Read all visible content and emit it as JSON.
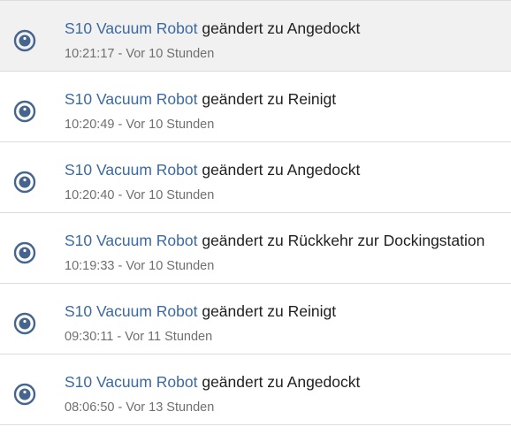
{
  "logbook": {
    "entries": [
      {
        "entity": "S10 Vacuum Robot",
        "message": "geändert zu Angedockt",
        "time": "10:21:17",
        "relative": "Vor 10 Stunden"
      },
      {
        "entity": "S10 Vacuum Robot",
        "message": "geändert zu Reinigt",
        "time": "10:20:49",
        "relative": "Vor 10 Stunden"
      },
      {
        "entity": "S10 Vacuum Robot",
        "message": "geändert zu Angedockt",
        "time": "10:20:40",
        "relative": "Vor 10 Stunden"
      },
      {
        "entity": "S10 Vacuum Robot",
        "message": "geändert zu Rückkehr zur Dockingstation",
        "time": "10:19:33",
        "relative": "Vor 10 Stunden"
      },
      {
        "entity": "S10 Vacuum Robot",
        "message": "geändert zu Reinigt",
        "time": "09:30:11",
        "relative": "Vor 11 Stunden"
      },
      {
        "entity": "S10 Vacuum Robot",
        "message": "geändert zu Angedockt",
        "time": "08:06:50",
        "relative": "Vor 13 Stunden"
      }
    ],
    "separator": " - ",
    "icon": "robot-vacuum-icon",
    "colors": {
      "icon": "#45658e",
      "link": "#3c6a9e",
      "text": "#1f1f1f",
      "secondary": "#6f6f6f",
      "highlight": "#f1f1f1",
      "divider": "#dcdcdc"
    }
  }
}
